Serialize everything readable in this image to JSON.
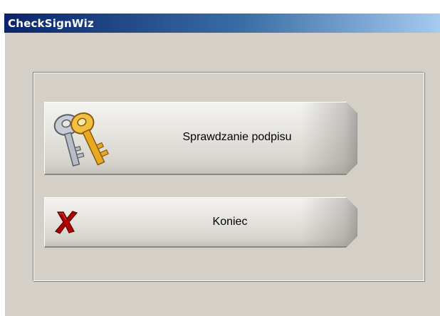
{
  "window": {
    "title": "CheckSignWiz"
  },
  "buttons": {
    "check_signature": {
      "label": "Sprawdzanie podpisu",
      "icon": "keys-icon"
    },
    "end": {
      "label": "Koniec",
      "icon": "red-x-icon"
    }
  },
  "colors": {
    "title_gradient_start": "#0a246a",
    "title_gradient_end": "#a6caf0",
    "window_background": "#d4d0c8",
    "x_icon": "#b00000",
    "key_gold": "#e8a820",
    "key_silver": "#b8bcc4"
  }
}
